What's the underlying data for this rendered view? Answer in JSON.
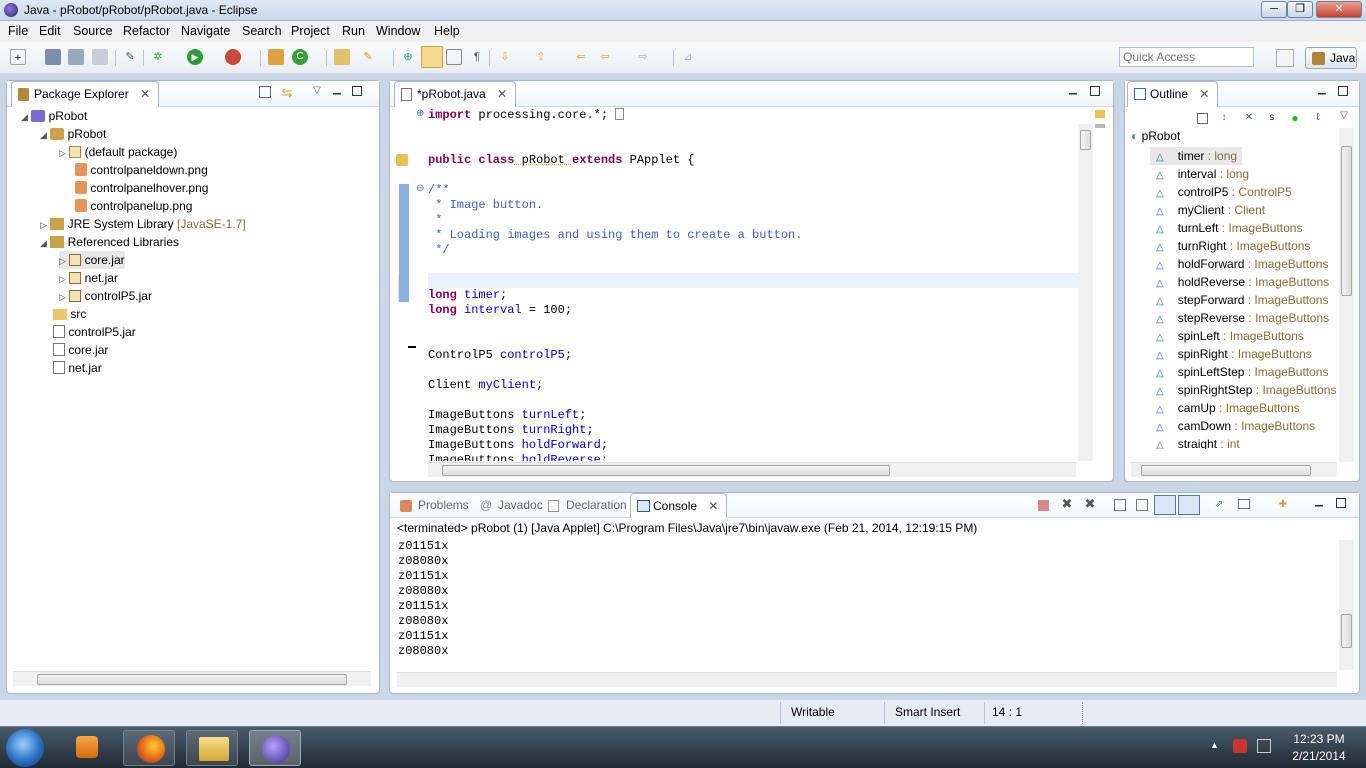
{
  "window": {
    "title": "Java - pRobot/pRobot/pRobot.java - Eclipse",
    "minimize": "─",
    "maximize": "❐",
    "close": "✕"
  },
  "menu": [
    "File",
    "Edit",
    "Source",
    "Refactor",
    "Navigate",
    "Search",
    "Project",
    "Run",
    "Window",
    "Help"
  ],
  "quick_access": {
    "placeholder": "Quick Access"
  },
  "perspective": {
    "label": "Java"
  },
  "package_explorer": {
    "tab": "Package Explorer",
    "tree": [
      {
        "label": "pRobot",
        "extra": ""
      },
      {
        "label": "pRobot",
        "extra": ""
      },
      {
        "label": "(default package)",
        "extra": ""
      },
      {
        "label": "controlpaneldown.png",
        "extra": ""
      },
      {
        "label": "controlpanelhover.png",
        "extra": ""
      },
      {
        "label": "controlpanelup.png",
        "extra": ""
      },
      {
        "label": "JRE System Library",
        "extra": "[JavaSE-1.7]"
      },
      {
        "label": "Referenced Libraries",
        "extra": ""
      },
      {
        "label": "core.jar",
        "extra": ""
      },
      {
        "label": "net.jar",
        "extra": ""
      },
      {
        "label": "controlP5.jar",
        "extra": ""
      },
      {
        "label": "src",
        "extra": ""
      },
      {
        "label": "controlP5.jar",
        "extra": ""
      },
      {
        "label": "core.jar",
        "extra": ""
      },
      {
        "label": "net.jar",
        "extra": ""
      }
    ]
  },
  "editor": {
    "tab": "*pRobot.java",
    "lines": [
      {
        "a": "import",
        "b": " processing.core.*;",
        "c": ""
      },
      {
        "a": "public class",
        "b": " pRobot ",
        "c": "extends"
      },
      {
        "a": "/**",
        "b": "",
        "c": ""
      },
      {
        "a": " * Image button.",
        "b": "",
        "c": ""
      },
      {
        "a": " *",
        "b": "",
        "c": ""
      },
      {
        "a": " * Loading images and using them to create a button.",
        "b": "",
        "c": ""
      },
      {
        "a": " */",
        "b": "",
        "c": ""
      },
      {
        "a": "long",
        "b": "timer",
        "c": ";"
      },
      {
        "a": "long",
        "b": "interval",
        "c": " = 100;"
      },
      {
        "a": "ControlP5 ",
        "b": "controlP5",
        "c": ";"
      },
      {
        "a": "Client ",
        "b": "myClient",
        "c": ";"
      },
      {
        "a": "ImageButtons ",
        "b": "turnLeft",
        "c": ";"
      },
      {
        "a": "ImageButtons ",
        "b": "turnRight",
        "c": ";"
      },
      {
        "a": "ImageButtons ",
        "b": "holdForward",
        "c": ";"
      },
      {
        "a": "ImageButtons ",
        "b": "holdReverse",
        "c": ";"
      }
    ],
    "class_tail": " PApplet {"
  },
  "outline": {
    "tab": "Outline",
    "root": "pRobot",
    "items": [
      {
        "name": "timer",
        "type": "long"
      },
      {
        "name": "interval",
        "type": "long"
      },
      {
        "name": "controlP5",
        "type": "ControlP5"
      },
      {
        "name": "myClient",
        "type": "Client"
      },
      {
        "name": "turnLeft",
        "type": "ImageButtons"
      },
      {
        "name": "turnRight",
        "type": "ImageButtons"
      },
      {
        "name": "holdForward",
        "type": "ImageButtons"
      },
      {
        "name": "holdReverse",
        "type": "ImageButtons"
      },
      {
        "name": "stepForward",
        "type": "ImageButtons"
      },
      {
        "name": "stepReverse",
        "type": "ImageButtons"
      },
      {
        "name": "spinLeft",
        "type": "ImageButtons"
      },
      {
        "name": "spinRight",
        "type": "ImageButtons"
      },
      {
        "name": "spinLeftStep",
        "type": "ImageButtons"
      },
      {
        "name": "spinRightStep",
        "type": "ImageButtons"
      },
      {
        "name": "camUp",
        "type": "ImageButtons"
      },
      {
        "name": "camDown",
        "type": "ImageButtons"
      },
      {
        "name": "straight",
        "type": "int"
      }
    ]
  },
  "bottom": {
    "tabs": [
      "Problems",
      "Javadoc",
      "Declaration",
      "Console"
    ],
    "console_header": "<terminated> pRobot (1) [Java Applet] C:\\Program Files\\Java\\jre7\\bin\\javaw.exe (Feb 21, 2014, 12:19:15 PM)",
    "console_lines": [
      "z01151x",
      "z08080x",
      "z01151x",
      "z08080x",
      "z01151x",
      "z08080x",
      "z01151x",
      "z08080x"
    ]
  },
  "status": {
    "writable": "Writable",
    "insert": "Smart Insert",
    "position": "14 : 1"
  },
  "taskbar": {
    "time": "12:23 PM",
    "date": "2/21/2014"
  }
}
